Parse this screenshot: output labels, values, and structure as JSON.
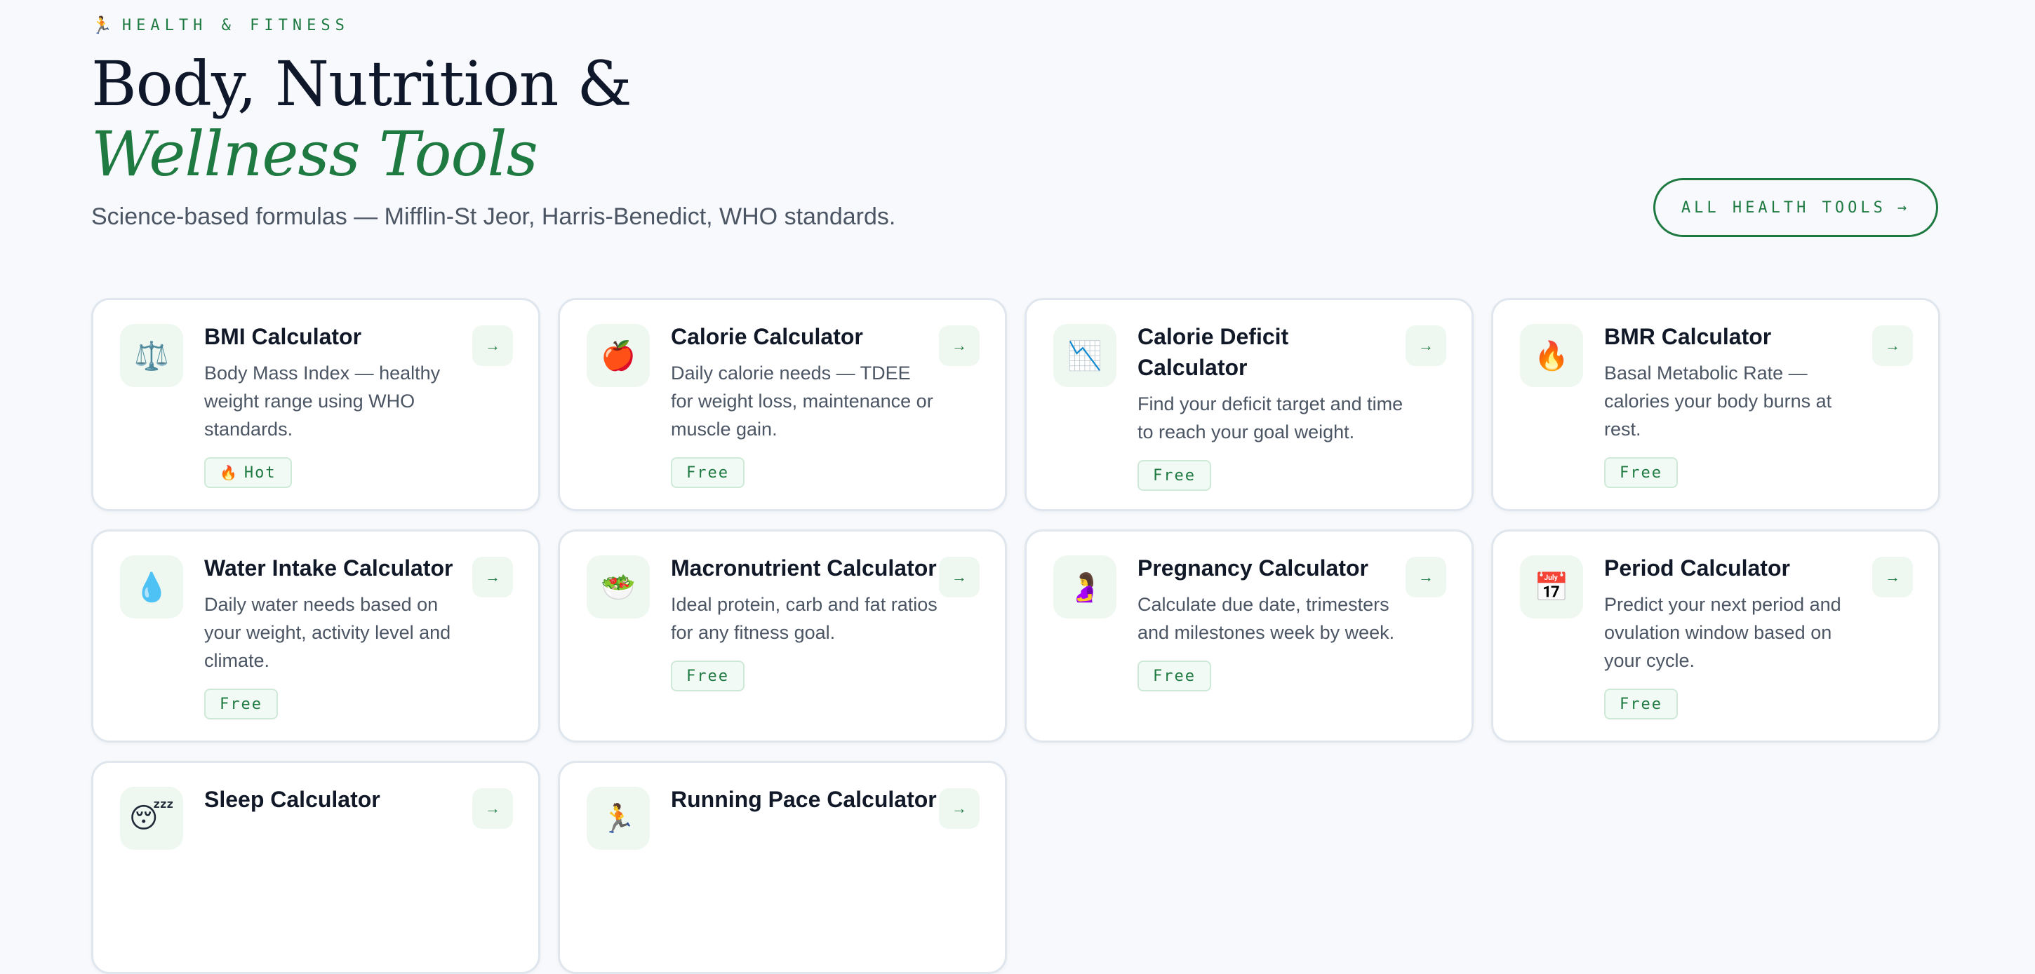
{
  "header": {
    "eyebrow_icon": "🏃",
    "eyebrow": "HEALTH & FITNESS",
    "title_line1": "Body, Nutrition &",
    "title_line2": "Wellness Tools",
    "subtitle": "Science-based formulas — Mifflin-St Jeor, Harris-Benedict, WHO standards.",
    "cta_label": "ALL HEALTH TOOLS",
    "cta_arrow": "→"
  },
  "colors": {
    "accent": "#1f7a42",
    "background": "#f7f9fc",
    "card_icon_bg": "#eef8f1"
  },
  "cards": [
    {
      "icon": "⚖️",
      "icon_name": "scales-icon",
      "title": "BMI Calculator",
      "desc": "Body Mass Index — healthy weight range using WHO standards.",
      "badge": "Hot",
      "badge_icon": "🔥",
      "arrow": "→"
    },
    {
      "icon": "🍎",
      "icon_name": "apple-icon",
      "title": "Calorie Calculator",
      "desc": "Daily calorie needs — TDEE for weight loss, maintenance or muscle gain.",
      "badge": "Free",
      "badge_icon": "",
      "arrow": "→"
    },
    {
      "icon": "📉",
      "icon_name": "chart-down-icon",
      "title": "Calorie Deficit Calculator",
      "desc": "Find your deficit target and time to reach your goal weight.",
      "badge": "Free",
      "badge_icon": "",
      "arrow": "→"
    },
    {
      "icon": "🔥",
      "icon_name": "fire-icon",
      "title": "BMR Calculator",
      "desc": "Basal Metabolic Rate — calories your body burns at rest.",
      "badge": "Free",
      "badge_icon": "",
      "arrow": "→"
    },
    {
      "icon": "💧",
      "icon_name": "water-drop-icon",
      "title": "Water Intake Calculator",
      "desc": "Daily water needs based on your weight, activity level and climate.",
      "badge": "Free",
      "badge_icon": "",
      "arrow": "→"
    },
    {
      "icon": "🥗",
      "icon_name": "salad-icon",
      "title": "Macronutrient Calculator",
      "desc": "Ideal protein, carb and fat ratios for any fitness goal.",
      "badge": "Free",
      "badge_icon": "",
      "arrow": "→"
    },
    {
      "icon": "🤰",
      "icon_name": "pregnant-woman-icon",
      "title": "Pregnancy Calculator",
      "desc": "Calculate due date, trimesters and milestones week by week.",
      "badge": "Free",
      "badge_icon": "",
      "arrow": "→"
    },
    {
      "icon": "📅",
      "icon_name": "calendar-icon",
      "title": "Period Calculator",
      "desc": "Predict your next period and ovulation window based on your cycle.",
      "badge": "Free",
      "badge_icon": "",
      "arrow": "→"
    },
    {
      "icon": "😴",
      "icon_name": "sleeping-face-icon",
      "title": "Sleep Calculator",
      "desc": "",
      "badge": "",
      "badge_icon": "",
      "arrow": "→"
    },
    {
      "icon": "🏃",
      "icon_name": "runner-icon",
      "title": "Running Pace Calculator",
      "desc": "",
      "badge": "",
      "badge_icon": "",
      "arrow": "→"
    }
  ]
}
